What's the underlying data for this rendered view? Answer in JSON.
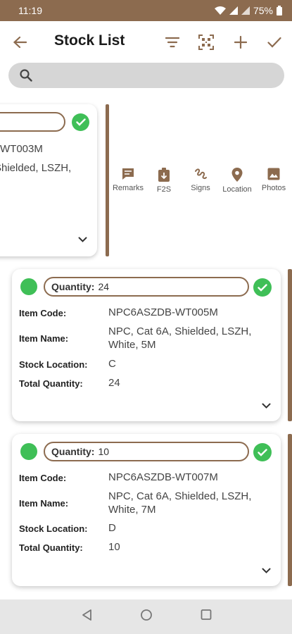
{
  "status_bar": {
    "time": "11:19",
    "battery": "75%"
  },
  "app_bar": {
    "title": "Stock List"
  },
  "search": {
    "placeholder": ""
  },
  "partial_card": {
    "item_code_fragment": "WT003M",
    "item_name_fragment": "Shielded, LSZH,"
  },
  "actions": [
    {
      "label": "Remarks",
      "icon": "remarks-icon"
    },
    {
      "label": "F2S",
      "icon": "f2s-icon"
    },
    {
      "label": "Signs",
      "icon": "signs-icon"
    },
    {
      "label": "Location",
      "icon": "location-icon"
    },
    {
      "label": "Photos",
      "icon": "photos-icon"
    }
  ],
  "field_labels": {
    "quantity": "Quantity:",
    "item_code": "Item Code:",
    "item_name": "Item Name:",
    "stock_location": "Stock Location:",
    "total_quantity": "Total Quantity:"
  },
  "items": [
    {
      "quantity": "24",
      "item_code": "NPC6ASZDB-WT005M",
      "item_name": "NPC, Cat 6A, Shielded, LSZH, White, 5M",
      "stock_location": "C",
      "total_quantity": "24"
    },
    {
      "quantity": "10",
      "item_code": "NPC6ASZDB-WT007M",
      "item_name": "NPC, Cat 6A, Shielded, LSZH, White, 7M",
      "stock_location": "D",
      "total_quantity": "10"
    }
  ],
  "colors": {
    "brand": "#8c6b4f",
    "success": "#3fbf57"
  }
}
